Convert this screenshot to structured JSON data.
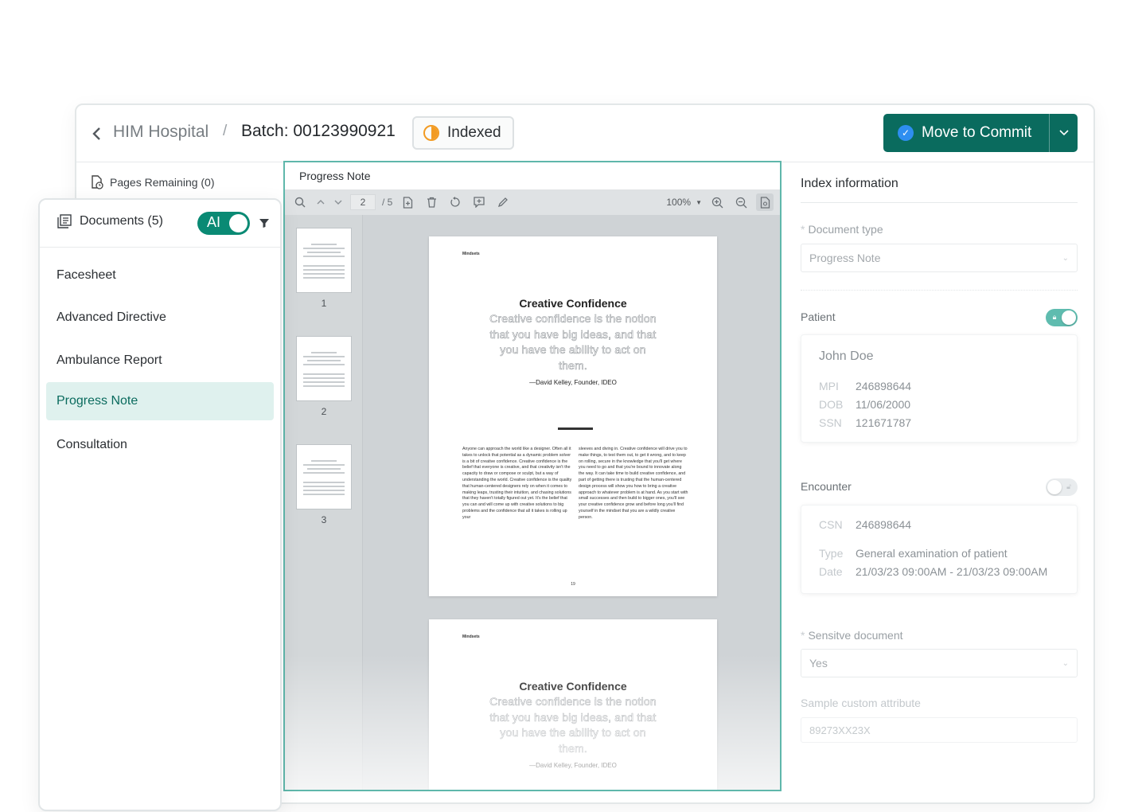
{
  "topbar": {
    "breadcrumb_home": "HIM Hospital",
    "separator": "/",
    "batch_label": "Batch: 00123990921",
    "status": "Indexed",
    "commit_label": "Move to Commit"
  },
  "pages_remaining": "Pages Remaining (0)",
  "documents": {
    "title": "Documents (5)",
    "ai_label": "AI",
    "ai_enabled": true,
    "items": [
      {
        "label": "Facesheet"
      },
      {
        "label": "Advanced Directive"
      },
      {
        "label": "Ambulance Report"
      },
      {
        "label": "Progress Note",
        "active": true
      },
      {
        "label": "Consultation"
      }
    ]
  },
  "viewer": {
    "title": "Progress Note",
    "current_page": "2",
    "total_pages": "/ 5",
    "zoom": "100%",
    "thumbnails": [
      "1",
      "2",
      "3"
    ],
    "pages": [
      {
        "header": "Mindsets",
        "title": "Creative Confidence",
        "quote": "Creative confidence is the notion that you have big ideas, and that you have the ability to act on them.",
        "attribution": "—David Kelley, Founder, IDEO",
        "col1": "Anyone can approach the world like a designer. Often all it takes to unlock that potential as a dynamic problem solver is a bit of creative confidence. Creative confidence is the belief that everyone is creative, and that creativity isn't the capacity to draw or compose or sculpt, but a way of understanding the world. Creative confidence is the quality that human-centered designers rely on when it comes to making leaps, trusting their intuition, and chasing solutions that they haven't totally figured out yet. It's the belief that you can and will come up with creative solutions to big problems and the confidence that all it takes is rolling up your",
        "col2": "sleeves and diving in. Creative confidence will drive you to make things, to test them out, to get it wrong, and to keep on rolling, secure in the knowledge that you'll get where you need to go and that you're bound to innovate along the way. It can take time to build creative confidence, and part of getting there is trusting that the human-centered design process will show you how to bring a creative approach to whatever problem is at hand. As you start with small successes and then build to bigger ones, you'll see your creative confidence grow and before long you'll find yourself in the mindset that you are a wildly creative person.",
        "page_number": "19"
      },
      {
        "header": "Mindsets",
        "title": "Creative Confidence",
        "quote": "Creative confidence is the notion that you have big ideas, and that you have the ability to act on them.",
        "attribution": "—David Kelley, Founder, IDEO"
      }
    ]
  },
  "index_info": {
    "title": "Index information",
    "document_type_label": "Document type",
    "document_type_value": "Progress Note",
    "patient_label": "Patient",
    "patient_locked": true,
    "patient": {
      "name": "John Doe",
      "fields": [
        {
          "key": "MPI",
          "value": "246898644"
        },
        {
          "key": "DOB",
          "value": "11/06/2000"
        },
        {
          "key": "SSN",
          "value": "121671787"
        }
      ]
    },
    "encounter_label": "Encounter",
    "encounter_locked": false,
    "encounter": {
      "csn_key": "CSN",
      "csn_value": "246898644",
      "type_key": "Type",
      "type_value": "General examination of patient",
      "date_key": "Date",
      "date_value": "21/03/23 09:00AM - 21/03/23 09:00AM"
    },
    "sensitive_label": "Sensitve document",
    "sensitive_value": "Yes",
    "custom_attr_label": "Sample custom attribute",
    "custom_attr_value": "89273XX23X"
  },
  "colors": {
    "primary": "#0a6b5e",
    "ai_toggle": "#0a8a74",
    "viewer_border": "#5fb7ab",
    "status_indexed": "#f29b23",
    "active_item_bg": "#dff1ee"
  }
}
